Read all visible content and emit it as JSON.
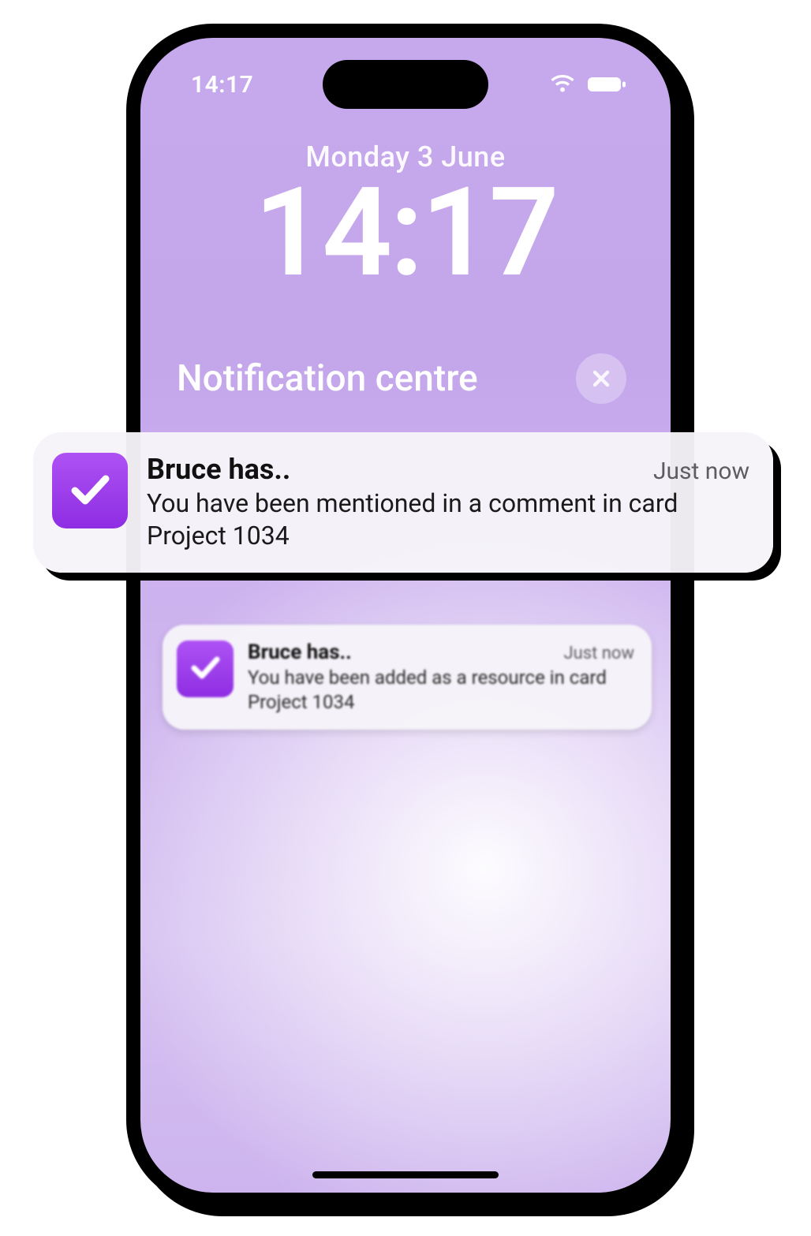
{
  "status": {
    "time": "14:17"
  },
  "lock": {
    "date": "Monday 3 June",
    "time": "14:17"
  },
  "notification_centre": {
    "title": "Notification centre"
  },
  "notifications": [
    {
      "app_icon": "checkmark-icon",
      "title": "Bruce has..",
      "time": "Just now",
      "message": "You have been mentioned in a comment in card Project 1034"
    },
    {
      "app_icon": "checkmark-icon",
      "title": "Bruce has..",
      "time": "Just now",
      "message": "You have been added as a resource in card Project 1034"
    }
  ],
  "colors": {
    "accent": "#9a38e6",
    "wallpaper_top": "#c6a8ec",
    "wallpaper_bottom": "#cdb4ee"
  }
}
